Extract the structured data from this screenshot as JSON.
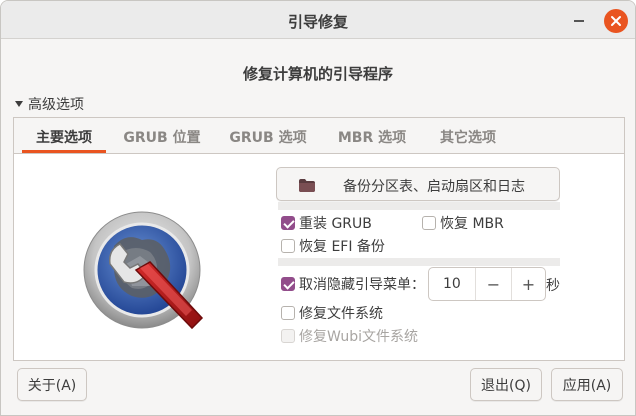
{
  "window": {
    "title": "引导修复"
  },
  "heading": "修复计算机的引导程序",
  "expander": {
    "label": "高级选项"
  },
  "tabs": [
    {
      "label": "主要选项",
      "active": true
    },
    {
      "label": "GRUB 位置",
      "active": false
    },
    {
      "label": "GRUB 选项",
      "active": false
    },
    {
      "label": "MBR 选项",
      "active": false
    },
    {
      "label": "其它选项",
      "active": false
    }
  ],
  "main": {
    "logo_icon": "boot-repair-wrench-icon",
    "backup_button": {
      "label": "备份分区表、启动扇区和日志",
      "icon": "folder-icon"
    },
    "options": {
      "reinstall_grub": {
        "label": "重装 GRUB",
        "checked": true
      },
      "restore_mbr": {
        "label": "恢复 MBR",
        "checked": false
      },
      "restore_efi": {
        "label": "恢复 EFI 备份",
        "checked": false
      },
      "unhide_menu": {
        "label": "取消隐藏引导菜单：",
        "checked": true
      },
      "repair_fs": {
        "label": "修复文件系统",
        "checked": false
      },
      "repair_wubi": {
        "label": "修复Wubi文件系统",
        "checked": false,
        "disabled": true
      }
    },
    "timeout": {
      "value": "10",
      "minus": "−",
      "plus": "+",
      "unit": "秒"
    }
  },
  "footer": {
    "about": "关于(A)",
    "quit": "退出(Q)",
    "apply": "应用(A)"
  },
  "colors": {
    "accent": "#e95420",
    "checkbox": "#924d8b"
  }
}
